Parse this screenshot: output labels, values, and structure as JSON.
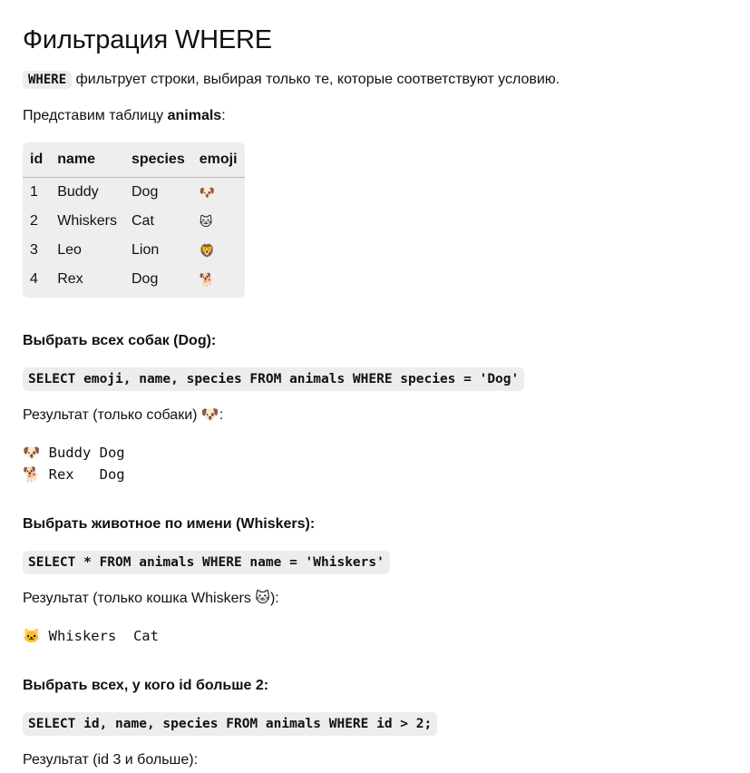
{
  "title": "Фильтрация WHERE",
  "intro": {
    "keyword": "WHERE",
    "text": " фильтрует строки, выбирая только те, которые соответствуют условию."
  },
  "lead": {
    "text": "Представим таблицу ",
    "table_name": "animals",
    "suffix": ":"
  },
  "table": {
    "headers": [
      "id",
      "name",
      "species",
      "emoji"
    ],
    "rows": [
      [
        "1",
        "Buddy",
        "Dog",
        "🐶"
      ],
      [
        "2",
        "Whiskers",
        "Cat",
        "🐱"
      ],
      [
        "3",
        "Leo",
        "Lion",
        "🦁"
      ],
      [
        "4",
        "Rex",
        "Dog",
        "🐕"
      ]
    ]
  },
  "sections": [
    {
      "title": "Выбрать всех собак (Dog):",
      "query": "SELECT emoji, name, species FROM animals WHERE species = 'Dog'",
      "result_label": "Результат (только собаки) 🐶:",
      "result_lines": [
        "🐶 Buddy Dog",
        "🐕 Rex   Dog"
      ]
    },
    {
      "title": "Выбрать животное по имени (Whiskers):",
      "query": "SELECT * FROM animals WHERE name = 'Whiskers'",
      "result_label": "Результат (только кошка Whiskers 🐱):",
      "result_lines": [
        "🐱 Whiskers  Cat"
      ]
    },
    {
      "title": "Выбрать всех, у кого id больше 2:",
      "query": "SELECT id, name, species FROM animals WHERE id > 2;",
      "result_label": "Результат (id 3 и больше):"
    }
  ]
}
